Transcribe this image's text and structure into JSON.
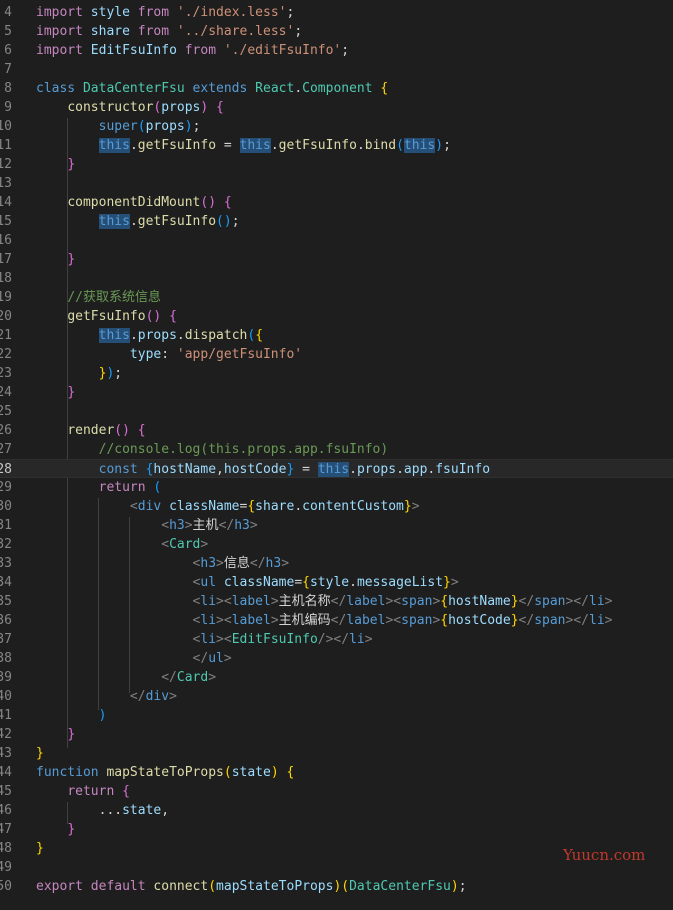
{
  "editor": {
    "lines": [
      {
        "n": "4",
        "t": [
          [
            "kw2",
            "import "
          ],
          [
            "var",
            "style "
          ],
          [
            "kw2",
            "from "
          ],
          [
            "str",
            "'./index.less'"
          ],
          [
            "txt",
            ";"
          ]
        ]
      },
      {
        "n": "5",
        "t": [
          [
            "kw2",
            "import "
          ],
          [
            "var",
            "share "
          ],
          [
            "kw2",
            "from "
          ],
          [
            "str",
            "'../share.less'"
          ],
          [
            "txt",
            ";"
          ]
        ]
      },
      {
        "n": "6",
        "t": [
          [
            "kw2",
            "import "
          ],
          [
            "var",
            "EditFsuInfo "
          ],
          [
            "kw2",
            "from "
          ],
          [
            "str",
            "'./editFsuInfo'"
          ],
          [
            "txt",
            ";"
          ]
        ]
      },
      {
        "n": "7",
        "t": []
      },
      {
        "n": "8",
        "t": [
          [
            "kw",
            "class "
          ],
          [
            "cls",
            "DataCenterFsu "
          ],
          [
            "kw",
            "extends "
          ],
          [
            "cls",
            "React"
          ],
          [
            "txt",
            "."
          ],
          [
            "cls",
            "Component "
          ],
          [
            "brk1",
            "{"
          ]
        ]
      },
      {
        "n": "9",
        "t": [
          [
            "txt",
            "    "
          ],
          [
            "fn",
            "constructor"
          ],
          [
            "brk2",
            "("
          ],
          [
            "var",
            "props"
          ],
          [
            "brk2",
            ")"
          ],
          [
            "txt",
            " "
          ],
          [
            "brk2",
            "{"
          ]
        ]
      },
      {
        "n": "10",
        "t": [
          [
            "txt",
            "        "
          ],
          [
            "kw",
            "super"
          ],
          [
            "brk3",
            "("
          ],
          [
            "var",
            "props"
          ],
          [
            "brk3",
            ")"
          ],
          [
            "txt",
            ";"
          ]
        ]
      },
      {
        "n": "11",
        "t": [
          [
            "txt",
            "        "
          ],
          [
            "this",
            "this"
          ],
          [
            "txt",
            "."
          ],
          [
            "fn",
            "getFsuInfo"
          ],
          [
            "txt",
            " = "
          ],
          [
            "this",
            "this"
          ],
          [
            "txt",
            "."
          ],
          [
            "fn",
            "getFsuInfo"
          ],
          [
            "txt",
            "."
          ],
          [
            "fn",
            "bind"
          ],
          [
            "brk3",
            "("
          ],
          [
            "this",
            "this"
          ],
          [
            "brk3",
            ")"
          ],
          [
            "txt",
            ";"
          ]
        ]
      },
      {
        "n": "12",
        "t": [
          [
            "txt",
            "    "
          ],
          [
            "brk2",
            "}"
          ]
        ]
      },
      {
        "n": "13",
        "t": []
      },
      {
        "n": "14",
        "t": [
          [
            "txt",
            "    "
          ],
          [
            "fn",
            "componentDidMount"
          ],
          [
            "brk2",
            "()"
          ],
          [
            "txt",
            " "
          ],
          [
            "brk2",
            "{"
          ]
        ]
      },
      {
        "n": "15",
        "t": [
          [
            "txt",
            "        "
          ],
          [
            "this",
            "this"
          ],
          [
            "txt",
            "."
          ],
          [
            "fn",
            "getFsuInfo"
          ],
          [
            "brk3",
            "()"
          ],
          [
            "txt",
            ";"
          ]
        ]
      },
      {
        "n": "16",
        "t": []
      },
      {
        "n": "17",
        "t": [
          [
            "txt",
            "    "
          ],
          [
            "brk2",
            "}"
          ]
        ]
      },
      {
        "n": "18",
        "t": []
      },
      {
        "n": "19",
        "t": [
          [
            "txt",
            "    "
          ],
          [
            "cmt",
            "//获取系统信息"
          ]
        ]
      },
      {
        "n": "20",
        "t": [
          [
            "txt",
            "    "
          ],
          [
            "fn",
            "getFsuInfo"
          ],
          [
            "brk2",
            "()"
          ],
          [
            "txt",
            " "
          ],
          [
            "brk2",
            "{"
          ]
        ]
      },
      {
        "n": "21",
        "t": [
          [
            "txt",
            "        "
          ],
          [
            "this",
            "this"
          ],
          [
            "txt",
            "."
          ],
          [
            "var",
            "props"
          ],
          [
            "txt",
            "."
          ],
          [
            "fn",
            "dispatch"
          ],
          [
            "brk3",
            "("
          ],
          [
            "brk1",
            "{"
          ]
        ]
      },
      {
        "n": "22",
        "t": [
          [
            "txt",
            "            "
          ],
          [
            "var",
            "type"
          ],
          [
            "txt",
            ": "
          ],
          [
            "str",
            "'app/getFsuInfo'"
          ]
        ]
      },
      {
        "n": "23",
        "t": [
          [
            "txt",
            "        "
          ],
          [
            "brk1",
            "}"
          ],
          [
            "brk3",
            ")"
          ],
          [
            "txt",
            ";"
          ]
        ]
      },
      {
        "n": "24",
        "t": [
          [
            "txt",
            "    "
          ],
          [
            "brk2",
            "}"
          ]
        ]
      },
      {
        "n": "25",
        "t": []
      },
      {
        "n": "26",
        "t": [
          [
            "txt",
            "    "
          ],
          [
            "fn",
            "render"
          ],
          [
            "brk2",
            "()"
          ],
          [
            "txt",
            " "
          ],
          [
            "brk2",
            "{"
          ]
        ]
      },
      {
        "n": "27",
        "t": [
          [
            "txt",
            "        "
          ],
          [
            "cmt",
            "//console.log(this.props.app.fsuInfo)"
          ]
        ]
      },
      {
        "n": "28",
        "current": true,
        "t": [
          [
            "txt",
            "        "
          ],
          [
            "kw",
            "const "
          ],
          [
            "brk3",
            "{"
          ],
          [
            "var",
            "hostName"
          ],
          [
            "txt",
            ","
          ],
          [
            "var",
            "hostCode"
          ],
          [
            "brk3",
            "}"
          ],
          [
            "txt",
            " = "
          ],
          [
            "this",
            "this"
          ],
          [
            "txt",
            "."
          ],
          [
            "var",
            "props"
          ],
          [
            "txt",
            "."
          ],
          [
            "var",
            "app"
          ],
          [
            "txt",
            "."
          ],
          [
            "var",
            "fsuInfo"
          ]
        ]
      },
      {
        "n": "29",
        "t": [
          [
            "txt",
            "        "
          ],
          [
            "kw2",
            "return "
          ],
          [
            "brk3",
            "("
          ]
        ]
      },
      {
        "n": "30",
        "t": [
          [
            "txt",
            "            "
          ],
          [
            "tagp",
            "<"
          ],
          [
            "tag",
            "div "
          ],
          [
            "var",
            "className"
          ],
          [
            "txt",
            "="
          ],
          [
            "brk1",
            "{"
          ],
          [
            "var",
            "share"
          ],
          [
            "txt",
            "."
          ],
          [
            "var",
            "contentCustom"
          ],
          [
            "brk1",
            "}"
          ],
          [
            "tagp",
            ">"
          ]
        ]
      },
      {
        "n": "31",
        "t": [
          [
            "txt",
            "                "
          ],
          [
            "tagp",
            "<"
          ],
          [
            "tag",
            "h3"
          ],
          [
            "tagp",
            ">"
          ],
          [
            "txt",
            "主机"
          ],
          [
            "tagp",
            "</"
          ],
          [
            "tag",
            "h3"
          ],
          [
            "tagp",
            ">"
          ]
        ]
      },
      {
        "n": "32",
        "t": [
          [
            "txt",
            "                "
          ],
          [
            "tagp",
            "<"
          ],
          [
            "cls",
            "Card"
          ],
          [
            "tagp",
            ">"
          ]
        ]
      },
      {
        "n": "33",
        "t": [
          [
            "txt",
            "                    "
          ],
          [
            "tagp",
            "<"
          ],
          [
            "tag",
            "h3"
          ],
          [
            "tagp",
            ">"
          ],
          [
            "txt",
            "信息"
          ],
          [
            "tagp",
            "</"
          ],
          [
            "tag",
            "h3"
          ],
          [
            "tagp",
            ">"
          ]
        ]
      },
      {
        "n": "34",
        "t": [
          [
            "txt",
            "                    "
          ],
          [
            "tagp",
            "<"
          ],
          [
            "tag",
            "ul "
          ],
          [
            "var",
            "className"
          ],
          [
            "txt",
            "="
          ],
          [
            "brk1",
            "{"
          ],
          [
            "var",
            "style"
          ],
          [
            "txt",
            "."
          ],
          [
            "var",
            "messageList"
          ],
          [
            "brk1",
            "}"
          ],
          [
            "tagp",
            ">"
          ]
        ]
      },
      {
        "n": "35",
        "t": [
          [
            "txt",
            "                    "
          ],
          [
            "tagp",
            "<"
          ],
          [
            "tag",
            "li"
          ],
          [
            "tagp",
            "><"
          ],
          [
            "tag",
            "label"
          ],
          [
            "tagp",
            ">"
          ],
          [
            "txt",
            "主机名称"
          ],
          [
            "tagp",
            "</"
          ],
          [
            "tag",
            "label"
          ],
          [
            "tagp",
            "><"
          ],
          [
            "tag",
            "span"
          ],
          [
            "tagp",
            ">"
          ],
          [
            "brk1",
            "{"
          ],
          [
            "var",
            "hostName"
          ],
          [
            "brk1",
            "}"
          ],
          [
            "tagp",
            "</"
          ],
          [
            "tag",
            "span"
          ],
          [
            "tagp",
            "></"
          ],
          [
            "tag",
            "li"
          ],
          [
            "tagp",
            ">"
          ]
        ]
      },
      {
        "n": "36",
        "t": [
          [
            "txt",
            "                    "
          ],
          [
            "tagp",
            "<"
          ],
          [
            "tag",
            "li"
          ],
          [
            "tagp",
            "><"
          ],
          [
            "tag",
            "label"
          ],
          [
            "tagp",
            ">"
          ],
          [
            "txt",
            "主机编码"
          ],
          [
            "tagp",
            "</"
          ],
          [
            "tag",
            "label"
          ],
          [
            "tagp",
            "><"
          ],
          [
            "tag",
            "span"
          ],
          [
            "tagp",
            ">"
          ],
          [
            "brk1",
            "{"
          ],
          [
            "var",
            "hostCode"
          ],
          [
            "brk1",
            "}"
          ],
          [
            "tagp",
            "</"
          ],
          [
            "tag",
            "span"
          ],
          [
            "tagp",
            "></"
          ],
          [
            "tag",
            "li"
          ],
          [
            "tagp",
            ">"
          ]
        ]
      },
      {
        "n": "37",
        "t": [
          [
            "txt",
            "                    "
          ],
          [
            "tagp",
            "<"
          ],
          [
            "tag",
            "li"
          ],
          [
            "tagp",
            "><"
          ],
          [
            "cls",
            "EditFsuInfo"
          ],
          [
            "tagp",
            "/></"
          ],
          [
            "tag",
            "li"
          ],
          [
            "tagp",
            ">"
          ]
        ]
      },
      {
        "n": "38",
        "t": [
          [
            "txt",
            "                    "
          ],
          [
            "tagp",
            "</"
          ],
          [
            "tag",
            "ul"
          ],
          [
            "tagp",
            ">"
          ]
        ]
      },
      {
        "n": "39",
        "t": [
          [
            "txt",
            "                "
          ],
          [
            "tagp",
            "</"
          ],
          [
            "cls",
            "Card"
          ],
          [
            "tagp",
            ">"
          ]
        ]
      },
      {
        "n": "40",
        "t": [
          [
            "txt",
            "            "
          ],
          [
            "tagp",
            "</"
          ],
          [
            "tag",
            "div"
          ],
          [
            "tagp",
            ">"
          ]
        ]
      },
      {
        "n": "41",
        "t": [
          [
            "txt",
            "        "
          ],
          [
            "brk3",
            ")"
          ]
        ]
      },
      {
        "n": "42",
        "t": [
          [
            "txt",
            "    "
          ],
          [
            "brk2",
            "}"
          ]
        ]
      },
      {
        "n": "43",
        "t": [
          [
            "brk1",
            "}"
          ]
        ]
      },
      {
        "n": "44",
        "t": [
          [
            "kw",
            "function "
          ],
          [
            "fn",
            "mapStateToProps"
          ],
          [
            "brk1",
            "("
          ],
          [
            "var",
            "state"
          ],
          [
            "brk1",
            ")"
          ],
          [
            "txt",
            " "
          ],
          [
            "brk1",
            "{"
          ]
        ]
      },
      {
        "n": "45",
        "t": [
          [
            "txt",
            "    "
          ],
          [
            "kw2",
            "return "
          ],
          [
            "brk2",
            "{"
          ]
        ]
      },
      {
        "n": "46",
        "t": [
          [
            "txt",
            "        ..."
          ],
          [
            "var",
            "state"
          ],
          [
            "txt",
            ","
          ]
        ]
      },
      {
        "n": "47",
        "t": [
          [
            "txt",
            "    "
          ],
          [
            "brk2",
            "}"
          ]
        ]
      },
      {
        "n": "48",
        "t": [
          [
            "brk1",
            "}"
          ]
        ]
      },
      {
        "n": "49",
        "t": []
      },
      {
        "n": "50",
        "t": [
          [
            "kw2",
            "export "
          ],
          [
            "kw2",
            "default "
          ],
          [
            "fn",
            "connect"
          ],
          [
            "brk1",
            "("
          ],
          [
            "var",
            "mapStateToProps"
          ],
          [
            "brk1",
            ")"
          ],
          [
            "brk1",
            "("
          ],
          [
            "cls",
            "DataCenterFsu"
          ],
          [
            "brk1",
            ")"
          ],
          [
            "txt",
            ";"
          ]
        ]
      }
    ]
  },
  "watermark": "Yuucn.com"
}
